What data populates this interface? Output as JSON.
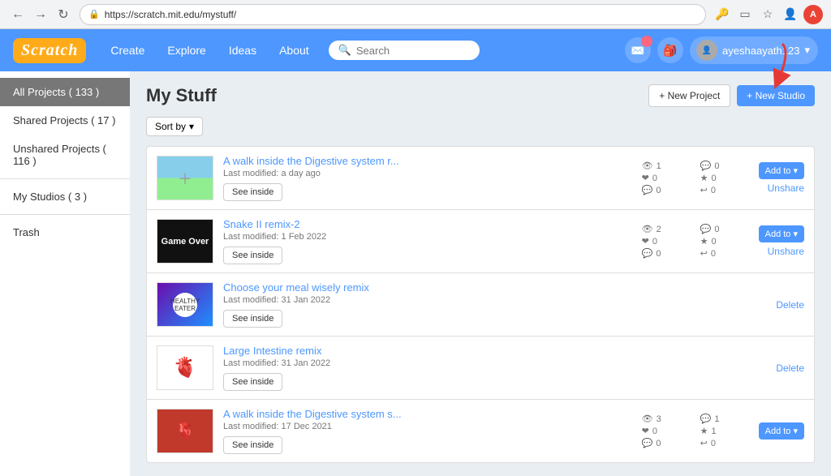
{
  "browser": {
    "url": "https://scratch.mit.edu/mystuff/",
    "nav_back": "←",
    "nav_forward": "→",
    "nav_refresh": "↻",
    "profile_initial": "A"
  },
  "navbar": {
    "logo": "Scratch",
    "links": [
      "Create",
      "Explore",
      "Ideas",
      "About"
    ],
    "search_placeholder": "Search",
    "user": "ayeshaayath123",
    "messages_badge": "",
    "bag_badge": ""
  },
  "sidebar": {
    "items": [
      {
        "label": "All Projects ( 133 )",
        "active": true
      },
      {
        "label": "Shared Projects ( 17 )",
        "active": false
      },
      {
        "label": "Unshared Projects ( 116 )",
        "active": false
      },
      {
        "label": "My Studios ( 3 )",
        "active": false
      },
      {
        "label": "Trash",
        "active": false
      }
    ]
  },
  "page": {
    "title": "My Stuff",
    "new_project_btn": "+ New Project",
    "new_studio_btn": "+ New Studio",
    "sort_btn": "Sort by"
  },
  "projects": [
    {
      "id": 1,
      "name": "A walk inside the Digestive system r...",
      "modified": "Last modified: a day ago",
      "has_add": true,
      "action": "Unshare",
      "stats": {
        "views": 1,
        "comments": 0,
        "loves": 0,
        "stars": 0,
        "remixes": 0,
        "replies": 0
      },
      "thumb_type": "digestive"
    },
    {
      "id": 2,
      "name": "Snake II remix-2",
      "modified": "Last modified: 1 Feb 2022",
      "has_add": true,
      "action": "Unshare",
      "stats": {
        "views": 2,
        "comments": 0,
        "loves": 0,
        "stars": 0,
        "remixes": 0,
        "replies": 0
      },
      "thumb_type": "snake",
      "thumb_text": "Game Over"
    },
    {
      "id": 3,
      "name": "Choose your meal wisely remix",
      "modified": "Last modified: 31 Jan 2022",
      "has_add": false,
      "action": "Delete",
      "stats": null,
      "thumb_type": "meal"
    },
    {
      "id": 4,
      "name": "Large Intestine remix",
      "modified": "Last modified: 31 Jan 2022",
      "has_add": false,
      "action": "Delete",
      "stats": null,
      "thumb_type": "intestine"
    },
    {
      "id": 5,
      "name": "A walk inside the Digestive system s...",
      "modified": "Last modified: 17 Dec 2021",
      "has_add": true,
      "action": null,
      "stats": {
        "views": 3,
        "comments": 1,
        "loves": 0,
        "stars": 1,
        "remixes": 0,
        "replies": 0
      },
      "thumb_type": "walk2"
    }
  ],
  "labels": {
    "see_inside": "See inside",
    "add_to": "Add to",
    "unshare": "Unshare",
    "delete": "Delete"
  }
}
